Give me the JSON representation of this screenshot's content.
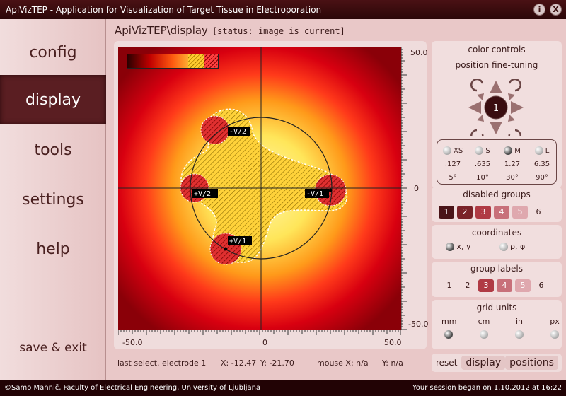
{
  "window": {
    "title": "ApiVizTEP - Application for Visualization of Target Tissue in Electroporation",
    "info_btn": "i",
    "close_btn": "X"
  },
  "nav": {
    "items": [
      "config",
      "display",
      "tools",
      "settings",
      "help"
    ],
    "active": "display",
    "exit": "save & exit"
  },
  "main": {
    "path": "ApiVizTEP\\display",
    "status": "[status: image is current]"
  },
  "plot": {
    "x_ticks": [
      "-50.0",
      "0",
      "50.0"
    ],
    "y_ticks": [
      "50.0",
      "0",
      "-50.0"
    ],
    "electrodes": [
      "-V/2",
      "+V/2",
      "-V/1",
      "+V/1"
    ]
  },
  "status": {
    "last": "last select. electrode 1",
    "x": "X: -12.47",
    "y": "Y: -21.70",
    "mouse_x": "mouse X: n/a",
    "mouse_y": "Y: n/a"
  },
  "color_controls": {
    "title": "color controls",
    "fine_tuning": "position fine-tuning",
    "electrode": "1"
  },
  "sizes": {
    "labels": [
      "XS",
      "S",
      "M",
      "L"
    ],
    "row1": [
      ".127",
      ".635",
      "1.27",
      "6.35"
    ],
    "row2": [
      "5°",
      "10°",
      "30°",
      "90°"
    ],
    "selected": "M"
  },
  "disabled_groups": {
    "title": "disabled groups",
    "items": [
      "1",
      "2",
      "3",
      "4",
      "5",
      "6"
    ]
  },
  "coordinates": {
    "title": "coordinates",
    "opt1": "x, y",
    "opt2": "ρ, φ",
    "selected": "x, y"
  },
  "group_labels": {
    "title": "group labels",
    "items": [
      "1",
      "2",
      "3",
      "4",
      "5",
      "6"
    ]
  },
  "grid_units": {
    "title": "grid units",
    "items": [
      "mm",
      "cm",
      "in",
      "px"
    ],
    "selected": "mm"
  },
  "buttons": {
    "reset": "reset",
    "display": "display",
    "positions": "positions"
  },
  "footer": {
    "left": "©Samo Mahnič, Faculty of Electrical Engineering, University of Ljubljana",
    "right": "Your session began on 1.10.2012 at 16:22"
  }
}
